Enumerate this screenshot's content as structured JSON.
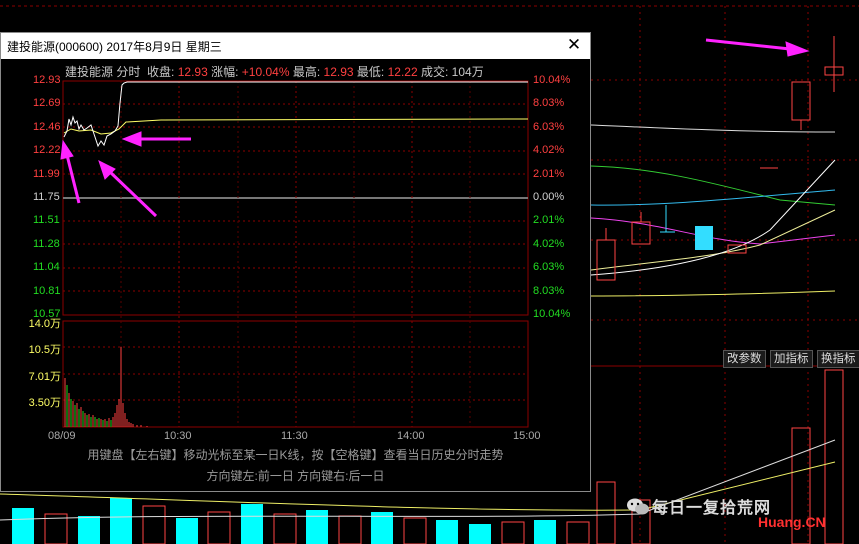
{
  "window": {
    "title": "建投能源(000600) 2017年8月9日 星期三",
    "close_label": "✕"
  },
  "info": {
    "name": "建投能源",
    "mode": "分时",
    "close_label": "收盘:",
    "close_value": "12.93",
    "change_label": "涨幅:",
    "change_value": "+10.04%",
    "high_label": "最高:",
    "high_value": "12.93",
    "low_label": "最低:",
    "low_value": "12.22",
    "volume_label": "成交:",
    "volume_value": "104万"
  },
  "colors": {
    "up": "#ff4040",
    "down": "#22dd22",
    "neutral": "#d0d0d0",
    "price_line": "#ffffff",
    "avg_line": "#ffff66",
    "arrow": "#ff22ff"
  },
  "price_axis": {
    "left": [
      "12.93",
      "12.69",
      "12.46",
      "12.22",
      "11.99",
      "11.75",
      "11.51",
      "11.28",
      "11.04",
      "10.81",
      "10.57"
    ],
    "right": [
      "10.04%",
      "8.03%",
      "6.03%",
      "4.02%",
      "2.01%",
      "0.00%",
      "2.01%",
      "4.02%",
      "6.03%",
      "8.03%",
      "10.04%"
    ]
  },
  "volume_axis": [
    "14.0万",
    "10.5万",
    "7.01万",
    "3.50万"
  ],
  "time_axis": [
    "08/09",
    "10:30",
    "11:30",
    "14:00",
    "15:00"
  ],
  "hints": {
    "line1": "用键盘【左右键】移动光标至某一日K线，按【空格键】查看当日历史分时走势",
    "line2": "方向键左:前一日    方向键右:后一日"
  },
  "buttons": [
    "改参数",
    "加指标",
    "换指标"
  ],
  "watermark": {
    "text": "每日一复拾荒网",
    "site": "Huang.CN"
  }
}
